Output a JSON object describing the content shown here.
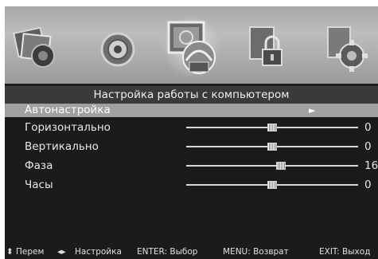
{
  "title": "Настройка работы с компьютером",
  "icons": [
    "picture-settings-icon",
    "sound-settings-icon",
    "pc-adjust-icon",
    "lock-icon",
    "options-gear-icon"
  ],
  "active_icon": 2,
  "menu": {
    "autoadjust": {
      "label": "Автонастройка",
      "arrow": "►"
    },
    "horizontal": {
      "label": "Горизонтально",
      "value": "0",
      "level": 0.5
    },
    "vertical": {
      "label": "Вертикально",
      "value": "0",
      "level": 0.5
    },
    "phase": {
      "label": "Фаза",
      "value": "16",
      "level": 0.55
    },
    "clock": {
      "label": "Часы",
      "value": "0",
      "level": 0.5
    }
  },
  "footer": {
    "move_symbol": "⬍",
    "move": "Перем",
    "adjust_symbol": "◂▸",
    "adjust": "Настройка",
    "enter": "ENTER: Выбор",
    "menu": "MENU: Возврат",
    "exit": "EXIT: Выход"
  }
}
